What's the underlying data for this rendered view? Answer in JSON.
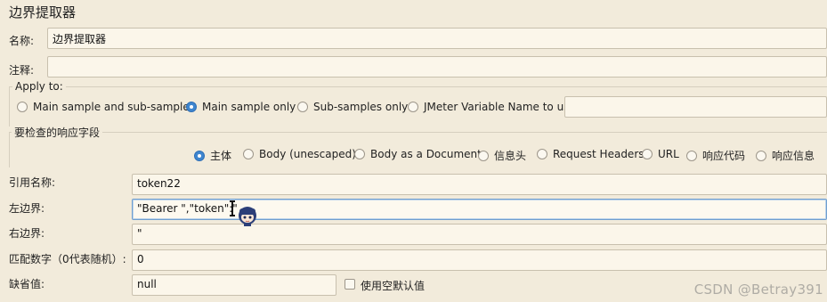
{
  "panel_title": "边界提取器",
  "name": {
    "label": "名称:",
    "value": "边界提取器"
  },
  "comment": {
    "label": "注释:",
    "value": ""
  },
  "apply_to": {
    "legend": "Apply to:",
    "options": [
      {
        "label": "Main sample and sub-samples",
        "selected": false
      },
      {
        "label": "Main sample only",
        "selected": true
      },
      {
        "label": "Sub-samples only",
        "selected": false
      },
      {
        "label": "JMeter Variable Name to use",
        "selected": false
      }
    ],
    "variable_name": ""
  },
  "response_field": {
    "legend": "要检查的响应字段",
    "options": [
      {
        "label": "主体",
        "selected": true
      },
      {
        "label": "Body (unescaped)",
        "selected": false
      },
      {
        "label": "Body as a Document",
        "selected": false
      },
      {
        "label": "信息头",
        "selected": false
      },
      {
        "label": "Request Headers",
        "selected": false
      },
      {
        "label": "URL",
        "selected": false
      },
      {
        "label": "响应代码",
        "selected": false
      },
      {
        "label": "响应信息",
        "selected": false
      }
    ]
  },
  "reference_name": {
    "label": "引用名称:",
    "value": "token22"
  },
  "left_boundary": {
    "label": "左边界:",
    "value": "\"Bearer \",\"token\":\""
  },
  "right_boundary": {
    "label": "右边界:",
    "value": "\""
  },
  "match_no": {
    "label": "匹配数字（0代表随机）:",
    "value": "0"
  },
  "default_value": {
    "label": "缺省值:",
    "value": "null",
    "use_empty_label": "使用空默认值",
    "use_empty_checked": false
  },
  "watermark": "CSDN @Betray391",
  "colors": {
    "background": "#f2ebdb",
    "field": "#fbf6ea",
    "radio_selected": "#3f86cf",
    "focus_border": "#6f9fcf"
  },
  "icons": {
    "cursor": "text-cursor-icon",
    "mascot": "avatar-sticker-icon"
  }
}
